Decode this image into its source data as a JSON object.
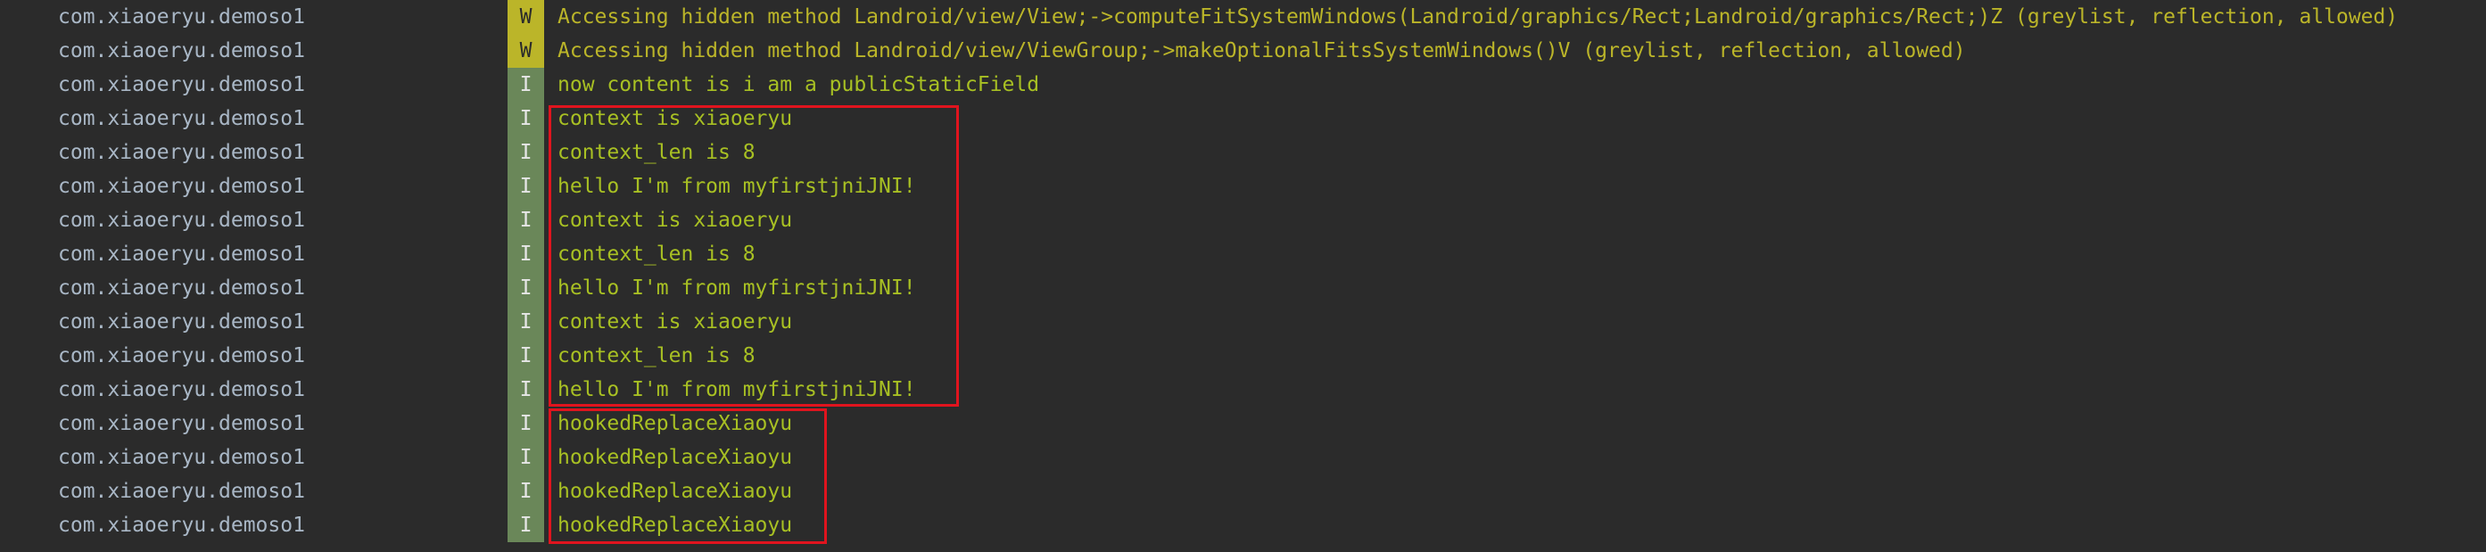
{
  "colors": {
    "background": "#2b2b2b",
    "package_text": "#a9b7c6",
    "warn_badge_bg": "#bbb529",
    "warn_badge_text": "#2b2b2b",
    "warn_text": "#bbb529",
    "info_badge_bg": "#6a8759",
    "info_badge_text": "#e6e6e6",
    "info_text": "#a8c023",
    "highlight_box": "#e0141e"
  },
  "log": {
    "rows": [
      {
        "package": "com.xiaoeryu.demoso1",
        "level": "W",
        "message": "Accessing hidden method Landroid/view/View;->computeFitSystemWindows(Landroid/graphics/Rect;Landroid/graphics/Rect;)Z (greylist, reflection, allowed)"
      },
      {
        "package": "com.xiaoeryu.demoso1",
        "level": "W",
        "message": "Accessing hidden method Landroid/view/ViewGroup;->makeOptionalFitsSystemWindows()V (greylist, reflection, allowed)"
      },
      {
        "package": "com.xiaoeryu.demoso1",
        "level": "I",
        "message": "now content is i am a publicStaticField"
      },
      {
        "package": "com.xiaoeryu.demoso1",
        "level": "I",
        "message": "context is xiaoeryu"
      },
      {
        "package": "com.xiaoeryu.demoso1",
        "level": "I",
        "message": "context_len is 8"
      },
      {
        "package": "com.xiaoeryu.demoso1",
        "level": "I",
        "message": "hello I'm from myfirstjniJNI!"
      },
      {
        "package": "com.xiaoeryu.demoso1",
        "level": "I",
        "message": "context is xiaoeryu"
      },
      {
        "package": "com.xiaoeryu.demoso1",
        "level": "I",
        "message": "context_len is 8"
      },
      {
        "package": "com.xiaoeryu.demoso1",
        "level": "I",
        "message": "hello I'm from myfirstjniJNI!"
      },
      {
        "package": "com.xiaoeryu.demoso1",
        "level": "I",
        "message": "context is xiaoeryu"
      },
      {
        "package": "com.xiaoeryu.demoso1",
        "level": "I",
        "message": "context_len is 8"
      },
      {
        "package": "com.xiaoeryu.demoso1",
        "level": "I",
        "message": "hello I'm from myfirstjniJNI!"
      },
      {
        "package": "com.xiaoeryu.demoso1",
        "level": "I",
        "message": "hookedReplaceXiaoyu"
      },
      {
        "package": "com.xiaoeryu.demoso1",
        "level": "I",
        "message": "hookedReplaceXiaoyu"
      },
      {
        "package": "com.xiaoeryu.demoso1",
        "level": "I",
        "message": "hookedReplaceXiaoyu"
      },
      {
        "package": "com.xiaoeryu.demoso1",
        "level": "I",
        "message": "hookedReplaceXiaoyu"
      }
    ]
  }
}
